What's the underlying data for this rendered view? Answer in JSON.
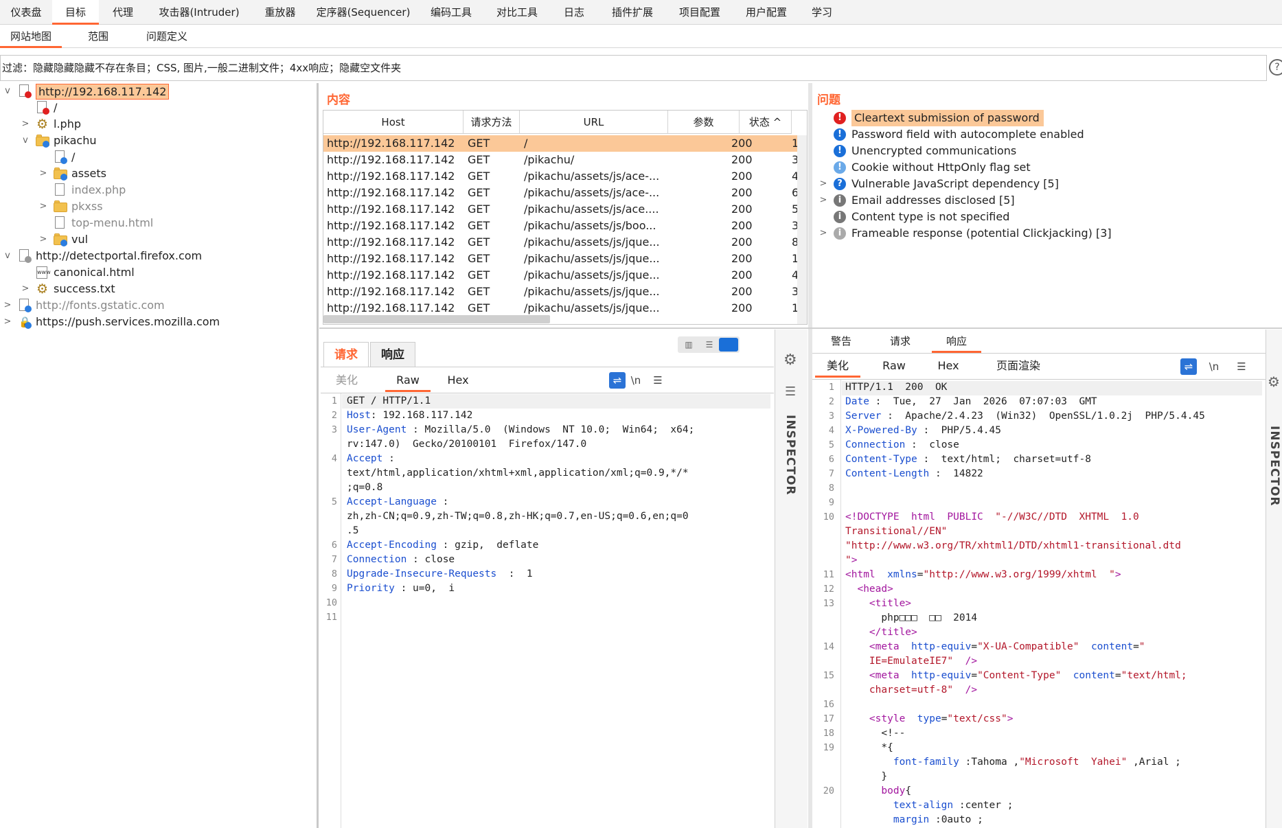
{
  "top_tabs": [
    "仪表盘",
    "目标",
    "代理",
    "攻击器(Intruder)",
    "重放器",
    "定序器(Sequencer)",
    "编码工具",
    "对比工具",
    "日志",
    "插件扩展",
    "项目配置",
    "用户配置",
    "学习"
  ],
  "active_top_tab": "目标",
  "sub_tabs": [
    "网站地图",
    "范围",
    "问题定义"
  ],
  "active_sub_tab": "网站地图",
  "filter": {
    "text": "过滤：隐藏隐藏隐藏不存在条目；CSS, 图片,一般二进制文件；4xx响应；隐藏空文件夹",
    "help": "?"
  },
  "tree": [
    {
      "label": "http://192.168.117.142",
      "expanded": "v"
    },
    {
      "label": "/"
    },
    {
      "label": "l.php",
      "collapsed": ">"
    },
    {
      "label": "pikachu",
      "expanded": "v"
    },
    {
      "label": "/"
    },
    {
      "label": "assets",
      "collapsed": ">"
    },
    {
      "label": "index.php"
    },
    {
      "label": "pkxss",
      "collapsed": ">"
    },
    {
      "label": "top-menu.html"
    },
    {
      "label": "vul",
      "collapsed": ">"
    },
    {
      "label": "http://detectportal.firefox.com",
      "expanded": "v"
    },
    {
      "label": "canonical.html"
    },
    {
      "label": "success.txt",
      "collapsed": ">"
    },
    {
      "label": "http://fonts.gstatic.com",
      "collapsed": ">"
    },
    {
      "label": "https://push.services.mozilla.com",
      "collapsed": ">"
    }
  ],
  "content": {
    "label": "内容",
    "columns": [
      "Host",
      "请求方法",
      "URL",
      "参数",
      "状态 ^"
    ],
    "rows": [
      [
        "http://192.168.117.142",
        "GET",
        "/",
        "",
        "200",
        "1"
      ],
      [
        "http://192.168.117.142",
        "GET",
        "/pikachu/",
        "",
        "200",
        "3"
      ],
      [
        "http://192.168.117.142",
        "GET",
        "/pikachu/assets/js/ace-...",
        "",
        "200",
        "4"
      ],
      [
        "http://192.168.117.142",
        "GET",
        "/pikachu/assets/js/ace-...",
        "",
        "200",
        "6"
      ],
      [
        "http://192.168.117.142",
        "GET",
        "/pikachu/assets/js/ace....",
        "",
        "200",
        "5"
      ],
      [
        "http://192.168.117.142",
        "GET",
        "/pikachu/assets/js/boo...",
        "",
        "200",
        "3"
      ],
      [
        "http://192.168.117.142",
        "GET",
        "/pikachu/assets/js/jque...",
        "",
        "200",
        "8"
      ],
      [
        "http://192.168.117.142",
        "GET",
        "/pikachu/assets/js/jque...",
        "",
        "200",
        "1"
      ],
      [
        "http://192.168.117.142",
        "GET",
        "/pikachu/assets/js/jque...",
        "",
        "200",
        "4"
      ],
      [
        "http://192.168.117.142",
        "GET",
        "/pikachu/assets/js/jque...",
        "",
        "200",
        "3"
      ],
      [
        "http://192.168.117.142",
        "GET",
        "/pikachu/assets/js/jque...",
        "",
        "200",
        "1"
      ]
    ]
  },
  "issues": {
    "label": "问题",
    "items": [
      {
        "text": "Cleartext submission of password",
        "color": "#e02020",
        "glyph": "!"
      },
      {
        "text": "Password field with autocomplete enabled",
        "color": "#1a6fd8",
        "glyph": "!"
      },
      {
        "text": "Unencrypted communications",
        "color": "#1a6fd8",
        "glyph": "!"
      },
      {
        "text": "Cookie without HttpOnly flag set",
        "color": "#6aa9e8",
        "glyph": "!"
      },
      {
        "text": "Vulnerable JavaScript dependency [5]",
        "color": "#1a6fd8",
        "glyph": "?",
        "chevron": ">"
      },
      {
        "text": "Email addresses disclosed [5]",
        "color": "#777777",
        "glyph": "i",
        "chevron": ">"
      },
      {
        "text": "Content type is not specified",
        "color": "#777777",
        "glyph": "i"
      },
      {
        "text": "Frameable response (potential Clickjacking) [3]",
        "color": "#aaaaaa",
        "glyph": "i",
        "chevron": ">"
      }
    ]
  },
  "request": {
    "tabs": [
      "请求",
      "响应"
    ],
    "view_tabs": [
      "美化",
      "Raw",
      "Hex"
    ],
    "newline_label": "\\n",
    "lines": [
      {
        "n": "1",
        "k": "",
        "v": "GET / HTTP/1.1"
      },
      {
        "n": "2",
        "k": "Host",
        "v": ": 192.168.117.142"
      },
      {
        "n": "3",
        "k": "User-Agent",
        "v": " : Mozilla/5.0  (Windows  NT 10.0;  Win64;  x64;"
      },
      {
        "n": "",
        "k": "",
        "v": "rv:147.0)  Gecko/20100101  Firefox/147.0"
      },
      {
        "n": "4",
        "k": "Accept",
        "v": " :"
      },
      {
        "n": "",
        "k": "",
        "v": "text/html,application/xhtml+xml,application/xml;q=0.9,*/*"
      },
      {
        "n": "",
        "k": "",
        "v": ";q=0.8"
      },
      {
        "n": "5",
        "k": "Accept-Language",
        "v": " :"
      },
      {
        "n": "",
        "k": "",
        "v": "zh,zh-CN;q=0.9,zh-TW;q=0.8,zh-HK;q=0.7,en-US;q=0.6,en;q=0"
      },
      {
        "n": "",
        "k": "",
        "v": ".5"
      },
      {
        "n": "6",
        "k": "Accept-Encoding",
        "v": " : gzip,  deflate"
      },
      {
        "n": "7",
        "k": "Connection",
        "v": " : close"
      },
      {
        "n": "8",
        "k": "Upgrade-Insecure-Requests",
        "v": "  :  1"
      },
      {
        "n": "9",
        "k": "Priority",
        "v": " : u=0,  i"
      },
      {
        "n": "10",
        "k": "",
        "v": ""
      },
      {
        "n": "11",
        "k": "",
        "v": ""
      }
    ],
    "inspector": "INSPECTOR"
  },
  "response": {
    "tabs": [
      "警告",
      "请求",
      "响应"
    ],
    "view_tabs": [
      "美化",
      "Raw",
      "Hex",
      "页面渲染"
    ],
    "newline_label": "\\n",
    "lines": [
      {
        "n": "1",
        "parts": [
          [
            "",
            "HTTP/1.1  200  OK"
          ]
        ]
      },
      {
        "n": "2",
        "parts": [
          [
            "key",
            "Date"
          ],
          [
            "",
            " :  Tue,  27  Jan  2026  07:07:03  GMT"
          ]
        ]
      },
      {
        "n": "3",
        "parts": [
          [
            "key",
            "Server"
          ],
          [
            "",
            " :  Apache/2.4.23  (Win32)  OpenSSL/1.0.2j  PHP/5.4.45"
          ]
        ]
      },
      {
        "n": "4",
        "parts": [
          [
            "key",
            "X-Powered-By"
          ],
          [
            "",
            " :  PHP/5.4.45"
          ]
        ]
      },
      {
        "n": "5",
        "parts": [
          [
            "key",
            "Connection"
          ],
          [
            "",
            " :  close"
          ]
        ]
      },
      {
        "n": "6",
        "parts": [
          [
            "key",
            "Content-Type"
          ],
          [
            "",
            " :  text/html;  charset=utf-8"
          ]
        ]
      },
      {
        "n": "7",
        "parts": [
          [
            "key",
            "Content-Length"
          ],
          [
            "",
            " :  14822"
          ]
        ]
      },
      {
        "n": "8",
        "parts": []
      },
      {
        "n": "9",
        "parts": []
      },
      {
        "n": "10",
        "parts": [
          [
            "tag",
            "<!DOCTYPE  html  PUBLIC  "
          ],
          [
            "str",
            "\"-//W3C//DTD  XHTML  1.0"
          ]
        ]
      },
      {
        "n": "",
        "parts": [
          [
            "str",
            "Transitional//EN\""
          ]
        ]
      },
      {
        "n": "",
        "parts": [
          [
            "str",
            "\"http://www.w3.org/TR/xhtml1/DTD/xhtml1-transitional.dtd"
          ]
        ]
      },
      {
        "n": "",
        "parts": [
          [
            "str",
            "\""
          ],
          [
            "tag",
            ">"
          ]
        ]
      },
      {
        "n": "11",
        "parts": [
          [
            "tag",
            "<html  "
          ],
          [
            "attr",
            "xmlns"
          ],
          [
            "",
            "="
          ],
          [
            "str",
            "\"http://www.w3.org/1999/xhtml  \""
          ],
          [
            "tag",
            ">"
          ]
        ]
      },
      {
        "n": "12",
        "parts": [
          [
            "",
            "  "
          ],
          [
            "tag",
            "<head>"
          ]
        ]
      },
      {
        "n": "13",
        "parts": [
          [
            "",
            "    "
          ],
          [
            "tag",
            "<title>"
          ]
        ]
      },
      {
        "n": "",
        "parts": [
          [
            "",
            "      php□□□  □□  2014"
          ]
        ]
      },
      {
        "n": "",
        "parts": [
          [
            "",
            "    "
          ],
          [
            "tag",
            "</title>"
          ]
        ]
      },
      {
        "n": "14",
        "parts": [
          [
            "",
            "    "
          ],
          [
            "tag",
            "<meta  "
          ],
          [
            "attr",
            "http-equiv"
          ],
          [
            "",
            "="
          ],
          [
            "str",
            "\"X-UA-Compatible\""
          ],
          [
            "",
            "  "
          ],
          [
            "attr",
            "content"
          ],
          [
            "",
            "="
          ],
          [
            "str",
            "\""
          ]
        ]
      },
      {
        "n": "",
        "parts": [
          [
            "str",
            "    IE=EmulateIE7\""
          ],
          [
            "tag",
            "  />"
          ]
        ]
      },
      {
        "n": "15",
        "parts": [
          [
            "",
            "    "
          ],
          [
            "tag",
            "<meta  "
          ],
          [
            "attr",
            "http-equiv"
          ],
          [
            "",
            "="
          ],
          [
            "str",
            "\"Content-Type\""
          ],
          [
            "",
            "  "
          ],
          [
            "attr",
            "content"
          ],
          [
            "",
            "="
          ],
          [
            "str",
            "\"text/html;"
          ]
        ]
      },
      {
        "n": "",
        "parts": [
          [
            "str",
            "    charset=utf-8\""
          ],
          [
            "tag",
            "  />"
          ]
        ]
      },
      {
        "n": "16",
        "parts": []
      },
      {
        "n": "17",
        "parts": [
          [
            "",
            "    "
          ],
          [
            "tag",
            "<style  "
          ],
          [
            "attr",
            "type"
          ],
          [
            "",
            "="
          ],
          [
            "str",
            "\"text/css\""
          ],
          [
            "tag",
            ">"
          ]
        ]
      },
      {
        "n": "18",
        "parts": [
          [
            "",
            "      <!--"
          ]
        ]
      },
      {
        "n": "19",
        "parts": [
          [
            "",
            "      *{"
          ]
        ]
      },
      {
        "n": "",
        "parts": [
          [
            "",
            "        "
          ],
          [
            "attr",
            "font-family"
          ],
          [
            "",
            " :Tahoma ,"
          ],
          [
            "str",
            "\"Microsoft  Yahei\""
          ],
          [
            "",
            " ,Arial ;"
          ]
        ]
      },
      {
        "n": "",
        "parts": [
          [
            "",
            "      }"
          ]
        ]
      },
      {
        "n": "20",
        "parts": [
          [
            "",
            "      "
          ],
          [
            "tag",
            "body"
          ],
          [
            "",
            "{"
          ]
        ]
      },
      {
        "n": "",
        "parts": [
          [
            "",
            "        "
          ],
          [
            "attr",
            "text-align"
          ],
          [
            "",
            " :center ;"
          ]
        ]
      },
      {
        "n": "",
        "parts": [
          [
            "",
            "        "
          ],
          [
            "attr",
            "margin"
          ],
          [
            "",
            " :0auto ;"
          ]
        ]
      }
    ],
    "inspector": "INSPECTOR"
  }
}
